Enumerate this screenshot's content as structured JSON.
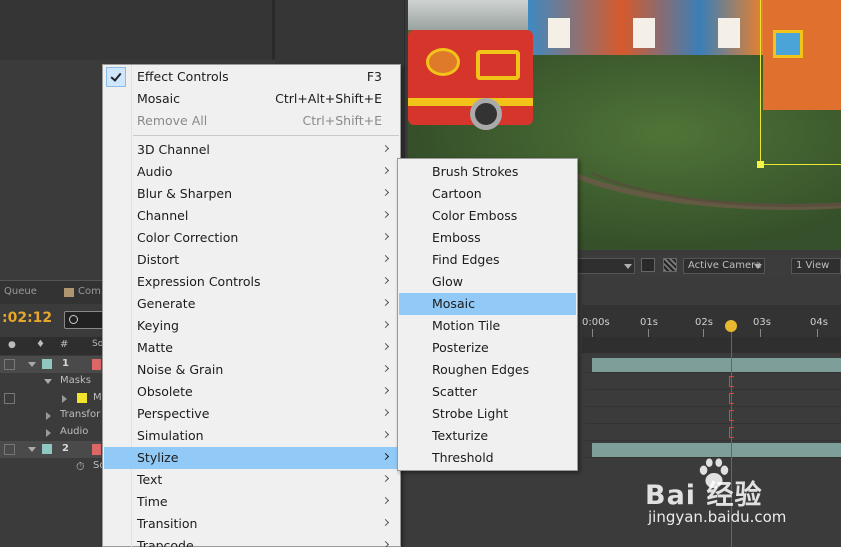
{
  "main_menu": {
    "items": [
      {
        "label": "Effect Controls",
        "shortcut": "F3",
        "checked": true
      },
      {
        "label": "Mosaic",
        "shortcut": "Ctrl+Alt+Shift+E"
      },
      {
        "label": "Remove All",
        "shortcut": "Ctrl+Shift+E",
        "disabled": true
      },
      {
        "label": "3D Channel",
        "submenu": true
      },
      {
        "label": "Audio",
        "submenu": true
      },
      {
        "label": "Blur & Sharpen",
        "submenu": true
      },
      {
        "label": "Channel",
        "submenu": true
      },
      {
        "label": "Color Correction",
        "submenu": true
      },
      {
        "label": "Distort",
        "submenu": true
      },
      {
        "label": "Expression Controls",
        "submenu": true
      },
      {
        "label": "Generate",
        "submenu": true
      },
      {
        "label": "Keying",
        "submenu": true
      },
      {
        "label": "Matte",
        "submenu": true
      },
      {
        "label": "Noise & Grain",
        "submenu": true
      },
      {
        "label": "Obsolete",
        "submenu": true
      },
      {
        "label": "Perspective",
        "submenu": true
      },
      {
        "label": "Simulation",
        "submenu": true
      },
      {
        "label": "Stylize",
        "submenu": true,
        "highlighted": true
      },
      {
        "label": "Text",
        "submenu": true
      },
      {
        "label": "Time",
        "submenu": true
      },
      {
        "label": "Transition",
        "submenu": true
      },
      {
        "label": "Trapcode",
        "submenu": true
      }
    ]
  },
  "stylize_submenu": {
    "items": [
      {
        "label": "Brush Strokes"
      },
      {
        "label": "Cartoon"
      },
      {
        "label": "Color Emboss"
      },
      {
        "label": "Emboss"
      },
      {
        "label": "Find Edges"
      },
      {
        "label": "Glow"
      },
      {
        "label": "Mosaic",
        "highlighted": true
      },
      {
        "label": "Motion Tile"
      },
      {
        "label": "Posterize"
      },
      {
        "label": "Roughen Edges"
      },
      {
        "label": "Scatter"
      },
      {
        "label": "Strobe Light"
      },
      {
        "label": "Texturize"
      },
      {
        "label": "Threshold"
      }
    ]
  },
  "viewer_toolbar": {
    "camera": "Active Camera",
    "views": "1 View"
  },
  "timeline": {
    "tab_queue": "Queue",
    "tab_comp": "Com",
    "timecode": ":02:12",
    "col_hash": "#",
    "col_source": "So",
    "ruler": [
      "0:00s",
      "01s",
      "02s",
      "03s",
      "04s"
    ],
    "layers": [
      {
        "num": "1",
        "label": "",
        "kind": "layer"
      },
      {
        "label": "Masks",
        "kind": "group"
      },
      {
        "label": "M",
        "kind": "mask"
      },
      {
        "label": "Transfor",
        "kind": "group"
      },
      {
        "label": "Audio",
        "kind": "group"
      },
      {
        "num": "2",
        "label": "",
        "kind": "layer"
      },
      {
        "label": "So",
        "kind": "prop"
      }
    ]
  },
  "watermark": {
    "logo_text": "Bai  经验",
    "url": "jingyan.baidu.com"
  },
  "colors": {
    "menu_bg": "#f0f0f0",
    "highlight": "#91c9f7",
    "timecode": "#e6a72c",
    "cti": "#dd3333"
  }
}
